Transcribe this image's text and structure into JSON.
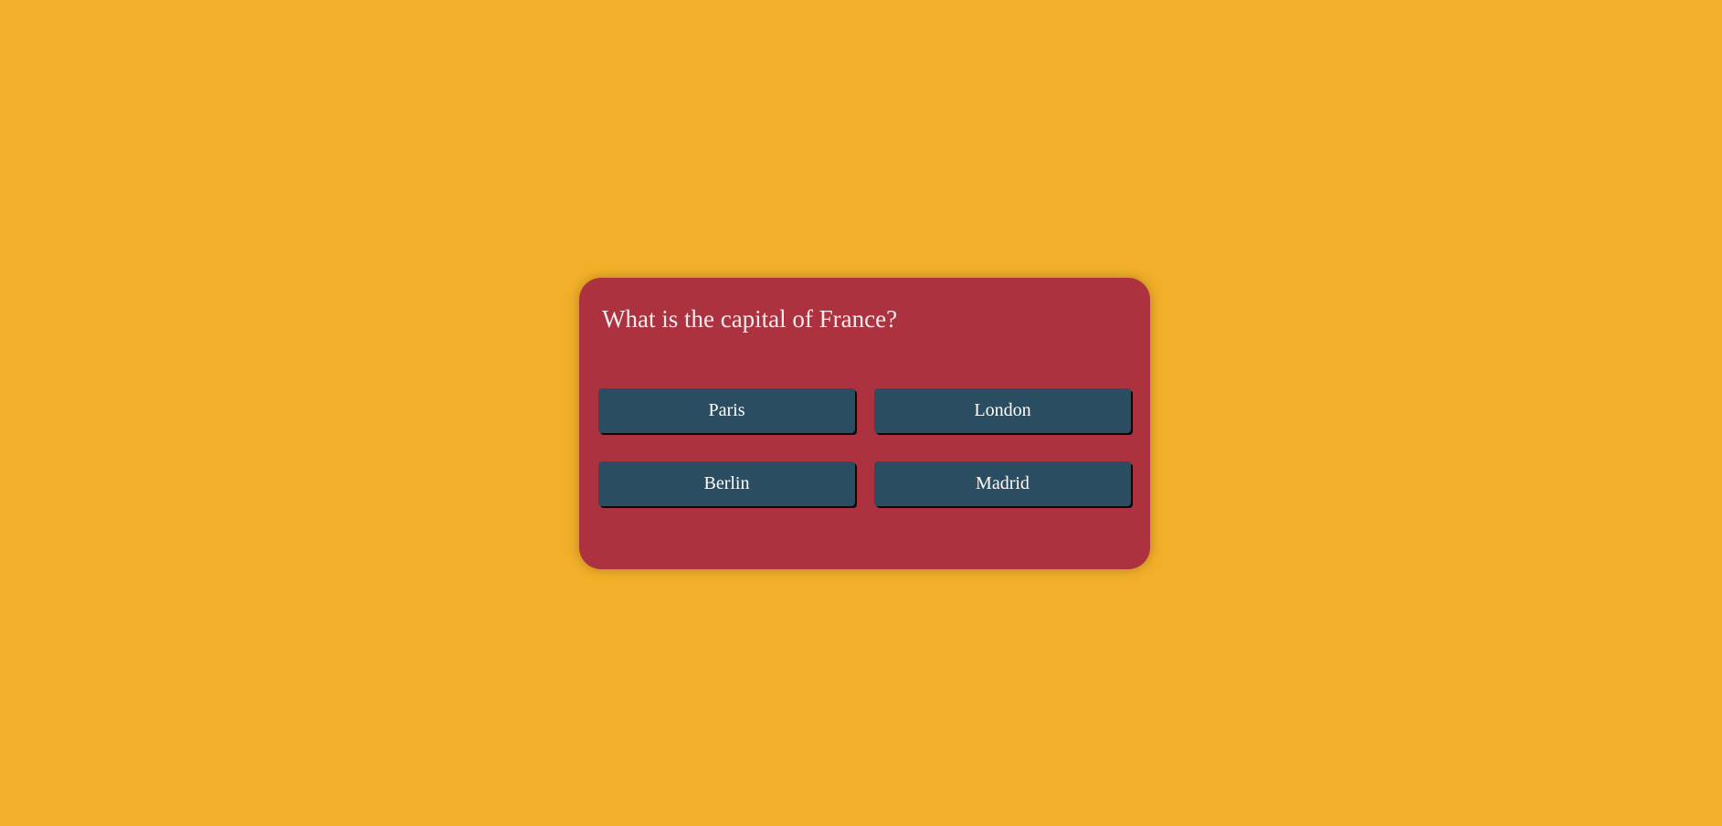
{
  "colors": {
    "page_background": "#F2AF29",
    "card_background": "#AD3240",
    "button_background": "#2A4D62",
    "question_text": "#F4ECEC",
    "button_text": "#FFFFFF"
  },
  "quiz": {
    "question": "What is the capital of France?",
    "answers": [
      {
        "label": "Paris"
      },
      {
        "label": "London"
      },
      {
        "label": "Berlin"
      },
      {
        "label": "Madrid"
      }
    ]
  }
}
